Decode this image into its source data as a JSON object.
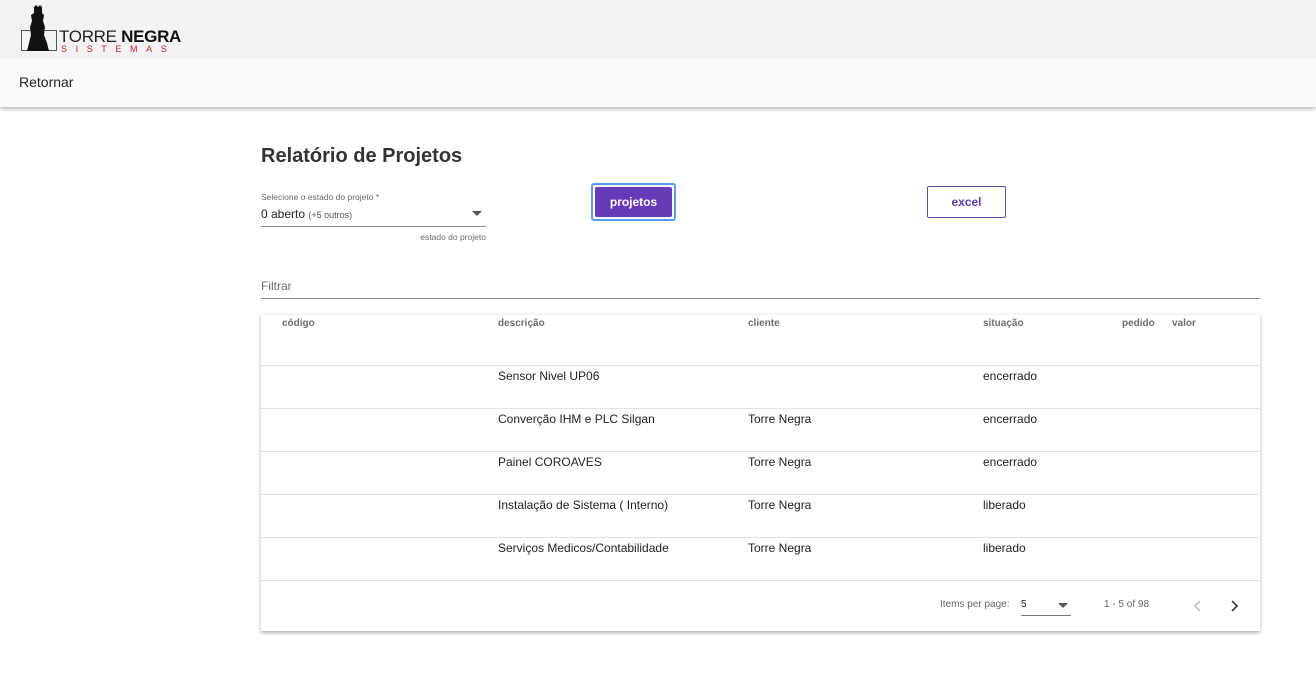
{
  "brand": {
    "name_part1": "TORRE ",
    "name_part2": "NEGRA",
    "tagline": "SISTEMAS",
    "accent": "#d3202f"
  },
  "nav": {
    "back_label": "Retornar"
  },
  "page": {
    "title": "Relatório de Projetos"
  },
  "state_select": {
    "label": "Selecione o estado do projeto *",
    "value": "0 aberto",
    "extra": "(+5 outros)",
    "hint": "estado do projeto"
  },
  "buttons": {
    "projetos": "projetos",
    "excel": "excel",
    "primary_color": "#673ab7"
  },
  "filter": {
    "placeholder": "Filtrar",
    "value": ""
  },
  "table": {
    "columns": [
      "código",
      "descrição",
      "cliente",
      "situação",
      "pedido",
      "valor"
    ],
    "rows": [
      {
        "codigo": "",
        "descricao": "Sensor Nivel UP06",
        "cliente": "",
        "situacao": "encerrado",
        "pedido": "",
        "valor": ""
      },
      {
        "codigo": "",
        "descricao": "Converção IHM e PLC Silgan",
        "cliente": "Torre Negra",
        "situacao": "encerrado",
        "pedido": "",
        "valor": ""
      },
      {
        "codigo": "",
        "descricao": "Painel COROAVES",
        "cliente": "Torre Negra",
        "situacao": "encerrado",
        "pedido": "",
        "valor": ""
      },
      {
        "codigo": "",
        "descricao": "Instalação de Sistema ( Interno)",
        "cliente": "Torre Negra",
        "situacao": "liberado",
        "pedido": "",
        "valor": ""
      },
      {
        "codigo": "",
        "descricao": "Serviços Medicos/Contabilidade",
        "cliente": "Torre Negra",
        "situacao": "liberado",
        "pedido": "",
        "valor": ""
      }
    ]
  },
  "paginator": {
    "items_per_page_label": "Items per page:",
    "items_per_page": "5",
    "range": "1 - 5 of 98",
    "prev_icon": "chevron-left-icon",
    "next_icon": "chevron-right-icon"
  }
}
